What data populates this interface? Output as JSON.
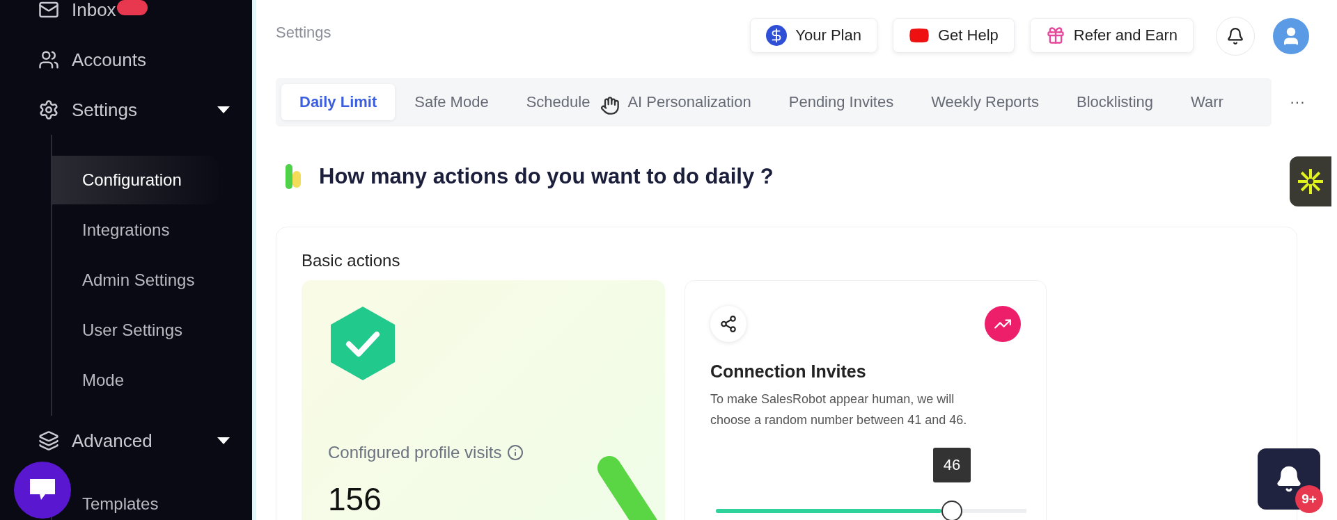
{
  "sidebar": {
    "items": [
      {
        "label": "Inbox",
        "has_badge": true
      },
      {
        "label": "Accounts"
      },
      {
        "label": "Settings",
        "expanded": true,
        "children": [
          {
            "label": "Configuration",
            "selected": true
          },
          {
            "label": "Integrations",
            "selected": false
          },
          {
            "label": "Admin Settings",
            "selected": false
          },
          {
            "label": "User Settings",
            "selected": false
          },
          {
            "label": "Mode",
            "selected": false
          }
        ]
      },
      {
        "label": "Advanced",
        "expanded": true,
        "children": [
          {
            "label": "Templates",
            "selected": false
          }
        ]
      }
    ]
  },
  "header": {
    "title": "Settings",
    "buttons": [
      {
        "label": "Your Plan"
      },
      {
        "label": "Get Help"
      },
      {
        "label": "Refer and Earn"
      }
    ]
  },
  "tabs": [
    {
      "label": "Daily Limit",
      "selected": true
    },
    {
      "label": "Safe Mode",
      "selected": false
    },
    {
      "label": "Schedule",
      "selected": false
    },
    {
      "label": "AI Personalization",
      "selected": false
    },
    {
      "label": "Pending Invites",
      "selected": false
    },
    {
      "label": "Weekly Reports",
      "selected": false
    },
    {
      "label": "Blocklisting",
      "selected": false
    },
    {
      "label": "Warr",
      "selected": false
    }
  ],
  "more_label": "···",
  "heading": "How many actions do you want to do daily ?",
  "section": {
    "title": "Basic actions",
    "summary": {
      "label": "Configured profile visits",
      "value": "156"
    },
    "connection": {
      "title": "Connection Invites",
      "description": "To make SalesRobot appear human, we will choose a random number between 41 and 46.",
      "slider": {
        "level": 0.76,
        "reading": "46"
      }
    }
  },
  "notifications": {
    "count": "9+"
  }
}
